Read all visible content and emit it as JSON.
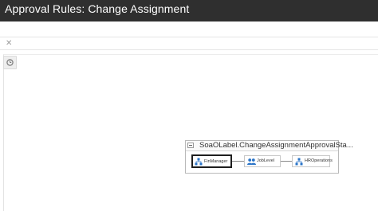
{
  "window": {
    "title": "Approval Rules: Change Assignment"
  },
  "toolbar": {
    "close_glyph": "✕"
  },
  "sidebar": {
    "button_icon": "clock-icon"
  },
  "diagram": {
    "title": "SoaOLabel.ChangeAssignmentApprovalSta...",
    "nodes": [
      {
        "label": "FinManager",
        "icon": "hierarchy-icon",
        "selected": true
      },
      {
        "label": "JobLevel",
        "icon": "users-icon",
        "selected": false
      },
      {
        "label": "HROperations",
        "icon": "hierarchy-icon",
        "selected": false
      }
    ]
  },
  "colors": {
    "titlebar": "#2f2f2f",
    "icon_blue": "#2b74c7"
  }
}
